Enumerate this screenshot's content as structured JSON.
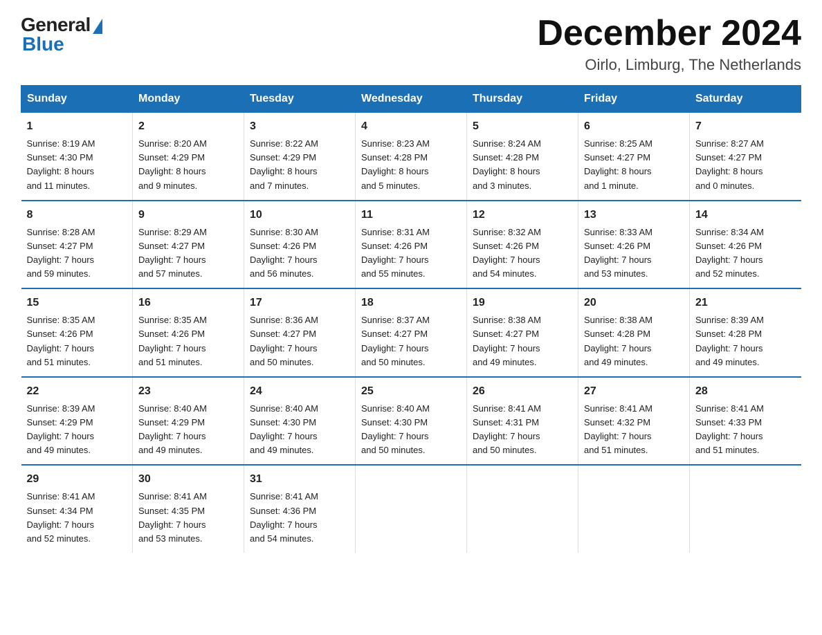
{
  "logo": {
    "general": "General",
    "blue": "Blue"
  },
  "title": "December 2024",
  "subtitle": "Oirlo, Limburg, The Netherlands",
  "weekdays": [
    "Sunday",
    "Monday",
    "Tuesday",
    "Wednesday",
    "Thursday",
    "Friday",
    "Saturday"
  ],
  "weeks": [
    [
      {
        "day": "1",
        "info": "Sunrise: 8:19 AM\nSunset: 4:30 PM\nDaylight: 8 hours\nand 11 minutes."
      },
      {
        "day": "2",
        "info": "Sunrise: 8:20 AM\nSunset: 4:29 PM\nDaylight: 8 hours\nand 9 minutes."
      },
      {
        "day": "3",
        "info": "Sunrise: 8:22 AM\nSunset: 4:29 PM\nDaylight: 8 hours\nand 7 minutes."
      },
      {
        "day": "4",
        "info": "Sunrise: 8:23 AM\nSunset: 4:28 PM\nDaylight: 8 hours\nand 5 minutes."
      },
      {
        "day": "5",
        "info": "Sunrise: 8:24 AM\nSunset: 4:28 PM\nDaylight: 8 hours\nand 3 minutes."
      },
      {
        "day": "6",
        "info": "Sunrise: 8:25 AM\nSunset: 4:27 PM\nDaylight: 8 hours\nand 1 minute."
      },
      {
        "day": "7",
        "info": "Sunrise: 8:27 AM\nSunset: 4:27 PM\nDaylight: 8 hours\nand 0 minutes."
      }
    ],
    [
      {
        "day": "8",
        "info": "Sunrise: 8:28 AM\nSunset: 4:27 PM\nDaylight: 7 hours\nand 59 minutes."
      },
      {
        "day": "9",
        "info": "Sunrise: 8:29 AM\nSunset: 4:27 PM\nDaylight: 7 hours\nand 57 minutes."
      },
      {
        "day": "10",
        "info": "Sunrise: 8:30 AM\nSunset: 4:26 PM\nDaylight: 7 hours\nand 56 minutes."
      },
      {
        "day": "11",
        "info": "Sunrise: 8:31 AM\nSunset: 4:26 PM\nDaylight: 7 hours\nand 55 minutes."
      },
      {
        "day": "12",
        "info": "Sunrise: 8:32 AM\nSunset: 4:26 PM\nDaylight: 7 hours\nand 54 minutes."
      },
      {
        "day": "13",
        "info": "Sunrise: 8:33 AM\nSunset: 4:26 PM\nDaylight: 7 hours\nand 53 minutes."
      },
      {
        "day": "14",
        "info": "Sunrise: 8:34 AM\nSunset: 4:26 PM\nDaylight: 7 hours\nand 52 minutes."
      }
    ],
    [
      {
        "day": "15",
        "info": "Sunrise: 8:35 AM\nSunset: 4:26 PM\nDaylight: 7 hours\nand 51 minutes."
      },
      {
        "day": "16",
        "info": "Sunrise: 8:35 AM\nSunset: 4:26 PM\nDaylight: 7 hours\nand 51 minutes."
      },
      {
        "day": "17",
        "info": "Sunrise: 8:36 AM\nSunset: 4:27 PM\nDaylight: 7 hours\nand 50 minutes."
      },
      {
        "day": "18",
        "info": "Sunrise: 8:37 AM\nSunset: 4:27 PM\nDaylight: 7 hours\nand 50 minutes."
      },
      {
        "day": "19",
        "info": "Sunrise: 8:38 AM\nSunset: 4:27 PM\nDaylight: 7 hours\nand 49 minutes."
      },
      {
        "day": "20",
        "info": "Sunrise: 8:38 AM\nSunset: 4:28 PM\nDaylight: 7 hours\nand 49 minutes."
      },
      {
        "day": "21",
        "info": "Sunrise: 8:39 AM\nSunset: 4:28 PM\nDaylight: 7 hours\nand 49 minutes."
      }
    ],
    [
      {
        "day": "22",
        "info": "Sunrise: 8:39 AM\nSunset: 4:29 PM\nDaylight: 7 hours\nand 49 minutes."
      },
      {
        "day": "23",
        "info": "Sunrise: 8:40 AM\nSunset: 4:29 PM\nDaylight: 7 hours\nand 49 minutes."
      },
      {
        "day": "24",
        "info": "Sunrise: 8:40 AM\nSunset: 4:30 PM\nDaylight: 7 hours\nand 49 minutes."
      },
      {
        "day": "25",
        "info": "Sunrise: 8:40 AM\nSunset: 4:30 PM\nDaylight: 7 hours\nand 50 minutes."
      },
      {
        "day": "26",
        "info": "Sunrise: 8:41 AM\nSunset: 4:31 PM\nDaylight: 7 hours\nand 50 minutes."
      },
      {
        "day": "27",
        "info": "Sunrise: 8:41 AM\nSunset: 4:32 PM\nDaylight: 7 hours\nand 51 minutes."
      },
      {
        "day": "28",
        "info": "Sunrise: 8:41 AM\nSunset: 4:33 PM\nDaylight: 7 hours\nand 51 minutes."
      }
    ],
    [
      {
        "day": "29",
        "info": "Sunrise: 8:41 AM\nSunset: 4:34 PM\nDaylight: 7 hours\nand 52 minutes."
      },
      {
        "day": "30",
        "info": "Sunrise: 8:41 AM\nSunset: 4:35 PM\nDaylight: 7 hours\nand 53 minutes."
      },
      {
        "day": "31",
        "info": "Sunrise: 8:41 AM\nSunset: 4:36 PM\nDaylight: 7 hours\nand 54 minutes."
      },
      {
        "day": "",
        "info": ""
      },
      {
        "day": "",
        "info": ""
      },
      {
        "day": "",
        "info": ""
      },
      {
        "day": "",
        "info": ""
      }
    ]
  ]
}
